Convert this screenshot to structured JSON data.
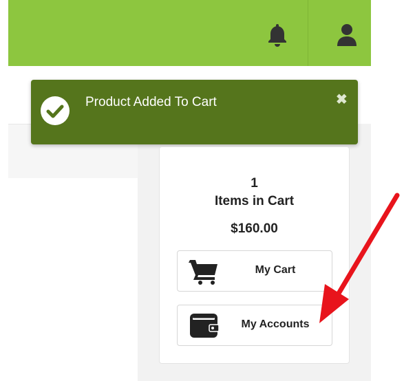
{
  "colors": {
    "header_green": "#8dc63f",
    "toast_green": "#55751c",
    "arrow_red": "#e8141c",
    "text_dark": "#222222"
  },
  "header": {
    "icons": [
      "bell-icon",
      "user-icon"
    ]
  },
  "toast": {
    "message": "Product Added To Cart",
    "icons": [
      "check-circle-icon",
      "close-icon"
    ]
  },
  "cart_summary": {
    "count": "1",
    "items_label": "Items in Cart",
    "total": "$160.00",
    "buttons": [
      {
        "label": "My Cart",
        "icon": "shopping-cart-icon"
      },
      {
        "label": "My Accounts",
        "icon": "wallet-icon"
      }
    ]
  },
  "annotation": {
    "icon": "red-arrow-icon"
  }
}
